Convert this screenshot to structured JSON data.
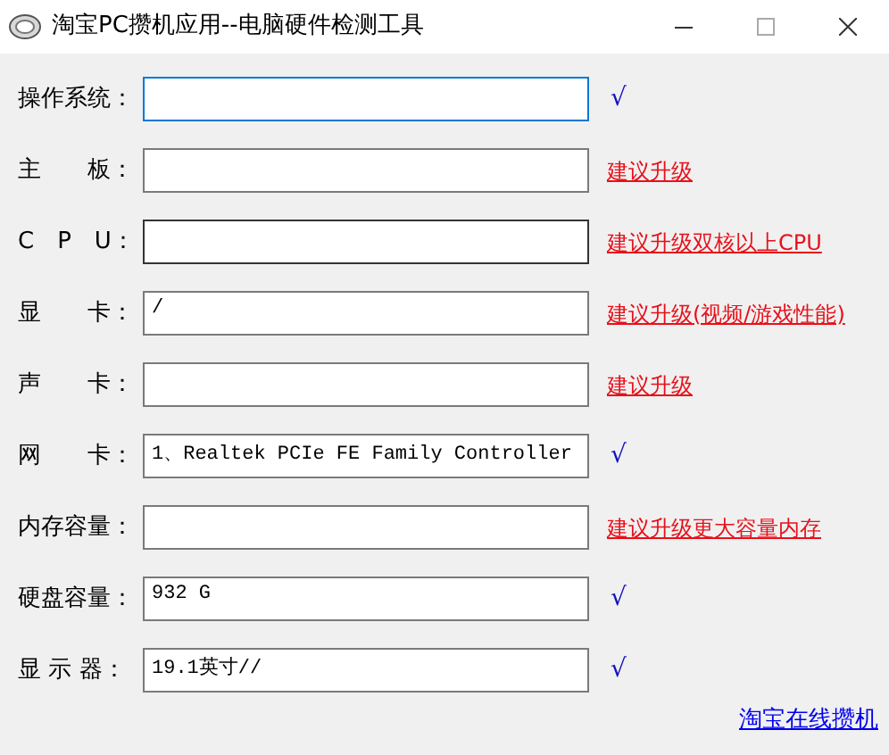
{
  "window": {
    "title": "淘宝PC攒机应用--电脑硬件检测工具"
  },
  "rows": [
    {
      "label": "操作系统：",
      "value": "",
      "focused": true,
      "hovered": false,
      "status": {
        "kind": "ok",
        "text": "√"
      }
    },
    {
      "label": "主　　板：",
      "value": "",
      "focused": false,
      "hovered": false,
      "status": {
        "kind": "advice",
        "text": "建议升级"
      }
    },
    {
      "label": "C　P　U：",
      "value": "",
      "focused": false,
      "hovered": true,
      "status": {
        "kind": "advice",
        "text": "建议升级双核以上CPU"
      }
    },
    {
      "label": "显　　卡：",
      "value": "/",
      "focused": false,
      "hovered": false,
      "status": {
        "kind": "advice",
        "text": "建议升级(视频/游戏性能)"
      }
    },
    {
      "label": "声　　卡：",
      "value": "",
      "focused": false,
      "hovered": false,
      "status": {
        "kind": "advice",
        "text": "建议升级"
      }
    },
    {
      "label": "网　　卡：",
      "value": "1、Realtek PCIe FE Family Controller",
      "focused": false,
      "hovered": false,
      "status": {
        "kind": "ok",
        "text": "√"
      }
    },
    {
      "label": "内存容量：",
      "value": "",
      "focused": false,
      "hovered": false,
      "status": {
        "kind": "advice",
        "text": "建议升级更大容量内存"
      }
    },
    {
      "label": "硬盘容量：",
      "value": "932 G",
      "focused": false,
      "hovered": false,
      "status": {
        "kind": "ok",
        "text": "√"
      }
    },
    {
      "label": "显 示 器：",
      "value": "19.1英寸//",
      "focused": false,
      "hovered": false,
      "status": {
        "kind": "ok",
        "text": "√"
      }
    }
  ],
  "footer_link": "淘宝在线攒机"
}
